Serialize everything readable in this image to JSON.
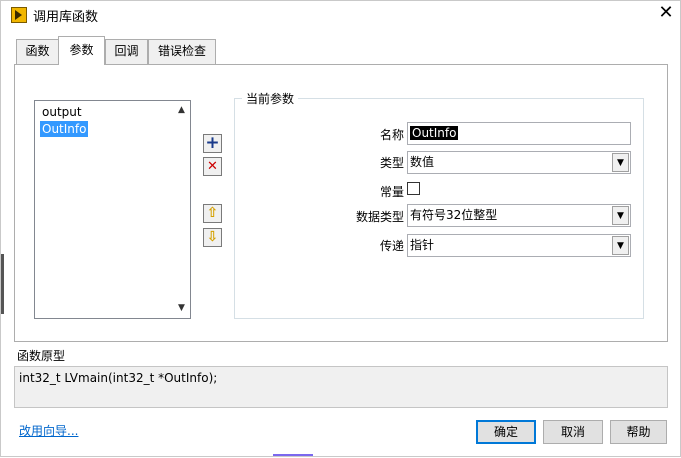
{
  "window": {
    "title": "调用库函数",
    "close_glyph": "✕"
  },
  "tabs": [
    {
      "label": "函数",
      "active": false
    },
    {
      "label": "参数",
      "active": true
    },
    {
      "label": "回调",
      "active": false
    },
    {
      "label": "错误检查",
      "active": false
    }
  ],
  "params_list": {
    "items": [
      "output",
      "OutInfo"
    ],
    "selected": "OutInfo"
  },
  "side_buttons": {
    "add_glyph": "+",
    "delete_glyph": "✕",
    "up_glyph": "⇧",
    "down_glyph": "⇩"
  },
  "current_param": {
    "group_title": "当前参数",
    "name_label": "名称",
    "name_value": "OutInfo",
    "type_label": "类型",
    "type_value": "数值",
    "const_label": "常量",
    "const_checked": false,
    "data_type_label": "数据类型",
    "data_type_value": "有符号32位整型",
    "pass_label": "传递",
    "pass_value": "指针"
  },
  "prototype": {
    "label": "函数原型",
    "text": "int32_t LVmain(int32_t *OutInfo);"
  },
  "footer": {
    "wizard_link": "改用向导...",
    "ok": "确定",
    "cancel": "取消",
    "help": "帮助"
  },
  "icons": {
    "app": "labview-icon",
    "dropdown": "chevron-down-icon"
  },
  "colors": {
    "selection": "#3399ff",
    "link": "#0066cc",
    "add_icon": "#1a3a8a",
    "delete_icon": "#cc0000",
    "arrow_icon": "#d4a000"
  }
}
